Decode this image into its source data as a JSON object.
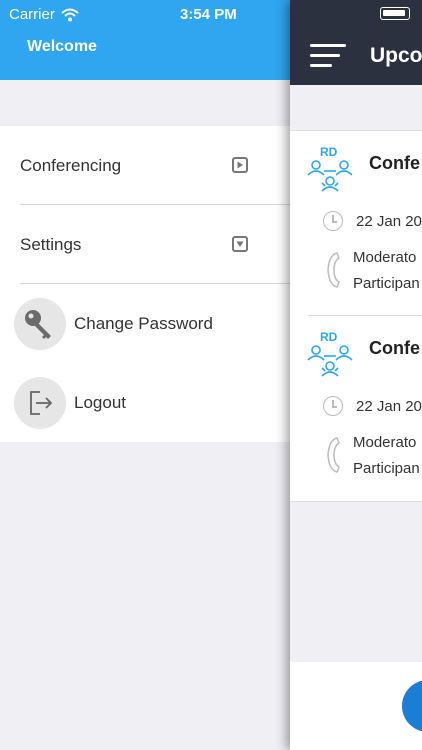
{
  "status_bar": {
    "carrier": "Carrier",
    "time": "3:54 PM"
  },
  "drawer": {
    "header_title": "Welcome",
    "items": [
      {
        "label": "Conferencing",
        "icon": "play-box-icon"
      },
      {
        "label": "Settings",
        "icon": "dropdown-box-icon"
      },
      {
        "label": "Change Password",
        "icon": "key-icon"
      },
      {
        "label": "Logout",
        "icon": "logout-icon"
      }
    ]
  },
  "main": {
    "title": "Upco",
    "cards": [
      {
        "badge": "RD",
        "title": "Confe",
        "date": "22 Jan 20",
        "moderator": "Moderato",
        "participant": "Participan"
      },
      {
        "badge": "RD",
        "title": "Confe",
        "date": "22 Jan 20",
        "moderator": "Moderato",
        "participant": "Participan"
      }
    ]
  },
  "colors": {
    "drawer_header": "#2fa6ef",
    "main_header": "#2c3140",
    "accent": "#2fa6ef",
    "fab": "#1a7dd6"
  }
}
